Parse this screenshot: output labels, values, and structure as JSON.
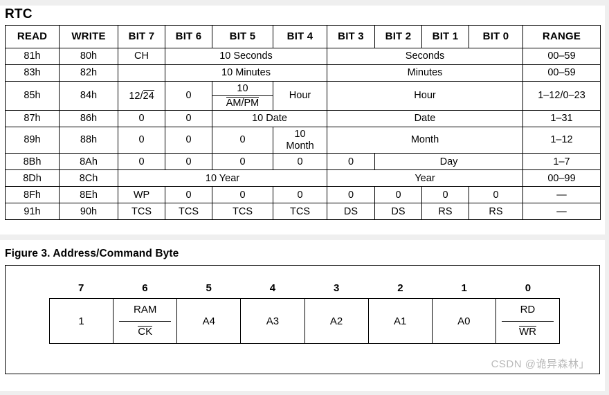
{
  "rtc_section": {
    "title": "RTC",
    "columns": [
      "READ",
      "WRITE",
      "BIT 7",
      "BIT 6",
      "BIT 5",
      "BIT 4",
      "BIT 3",
      "BIT 2",
      "BIT 1",
      "BIT 0",
      "RANGE"
    ],
    "rows": [
      {
        "read": "81h",
        "write": "80h",
        "bit7": "CH",
        "group_b6_b4": "10 Seconds",
        "group_b3_b0": "Seconds",
        "range": "00–59"
      },
      {
        "read": "83h",
        "write": "82h",
        "bit7": "",
        "group_b6_b4": "10 Minutes",
        "group_b3_b0": "Minutes",
        "range": "00–59"
      },
      {
        "read": "85h",
        "write": "84h",
        "bit7_a": "12/",
        "bit7_b": "24",
        "bit6": "0",
        "bit5_top": "10",
        "bit5_bot": "AM/PM",
        "bit4": "Hour",
        "group_b3_b0": "Hour",
        "range": "1–12/0–23"
      },
      {
        "read": "87h",
        "write": "86h",
        "bit7": "0",
        "bit6": "0",
        "group_b5_b4": "10 Date",
        "group_b3_b0": "Date",
        "range": "1–31"
      },
      {
        "read": "89h",
        "write": "88h",
        "bit7": "0",
        "bit6": "0",
        "bit5": "0",
        "bit4_top": "10",
        "bit4_bot": "Month",
        "group_b3_b0": "Month",
        "range": "1–12"
      },
      {
        "read": "8Bh",
        "write": "8Ah",
        "bit7": "0",
        "bit6": "0",
        "bit5": "0",
        "bit4": "0",
        "bit3": "0",
        "group_b2_b0": "Day",
        "range": "1–7"
      },
      {
        "read": "8Dh",
        "write": "8Ch",
        "group_b7_b4": "10 Year",
        "group_b3_b0": "Year",
        "range": "00–99"
      },
      {
        "read": "8Fh",
        "write": "8Eh",
        "bit7": "WP",
        "bit6": "0",
        "bit5": "0",
        "bit4": "0",
        "bit3": "0",
        "bit2": "0",
        "bit1": "0",
        "bit0": "0",
        "range": "—"
      },
      {
        "read": "91h",
        "write": "90h",
        "bit7": "TCS",
        "bit6": "TCS",
        "bit5": "TCS",
        "bit4": "TCS",
        "bit3": "DS",
        "bit2": "DS",
        "bit1": "RS",
        "bit0": "RS",
        "range": "—"
      }
    ]
  },
  "figure": {
    "caption": "Figure 3. Address/Command Byte",
    "bit_numbers": [
      "7",
      "6",
      "5",
      "4",
      "3",
      "2",
      "1",
      "0"
    ],
    "cells": [
      {
        "type": "plain",
        "label": "1"
      },
      {
        "type": "split",
        "top": "RAM",
        "bottom": "CK",
        "bottom_overline": true
      },
      {
        "type": "plain",
        "label": "A4"
      },
      {
        "type": "plain",
        "label": "A3"
      },
      {
        "type": "plain",
        "label": "A2"
      },
      {
        "type": "plain",
        "label": "A1"
      },
      {
        "type": "plain",
        "label": "A0"
      },
      {
        "type": "split",
        "top": "RD",
        "bottom": "WR",
        "bottom_overline": true
      }
    ]
  },
  "watermark": {
    "text": "CSDN @诡异森林」"
  },
  "colors": {
    "page_background": "#efefef",
    "panel_background": "#ffffff",
    "rule": "#000000",
    "watermark": "#b9b9b9"
  }
}
